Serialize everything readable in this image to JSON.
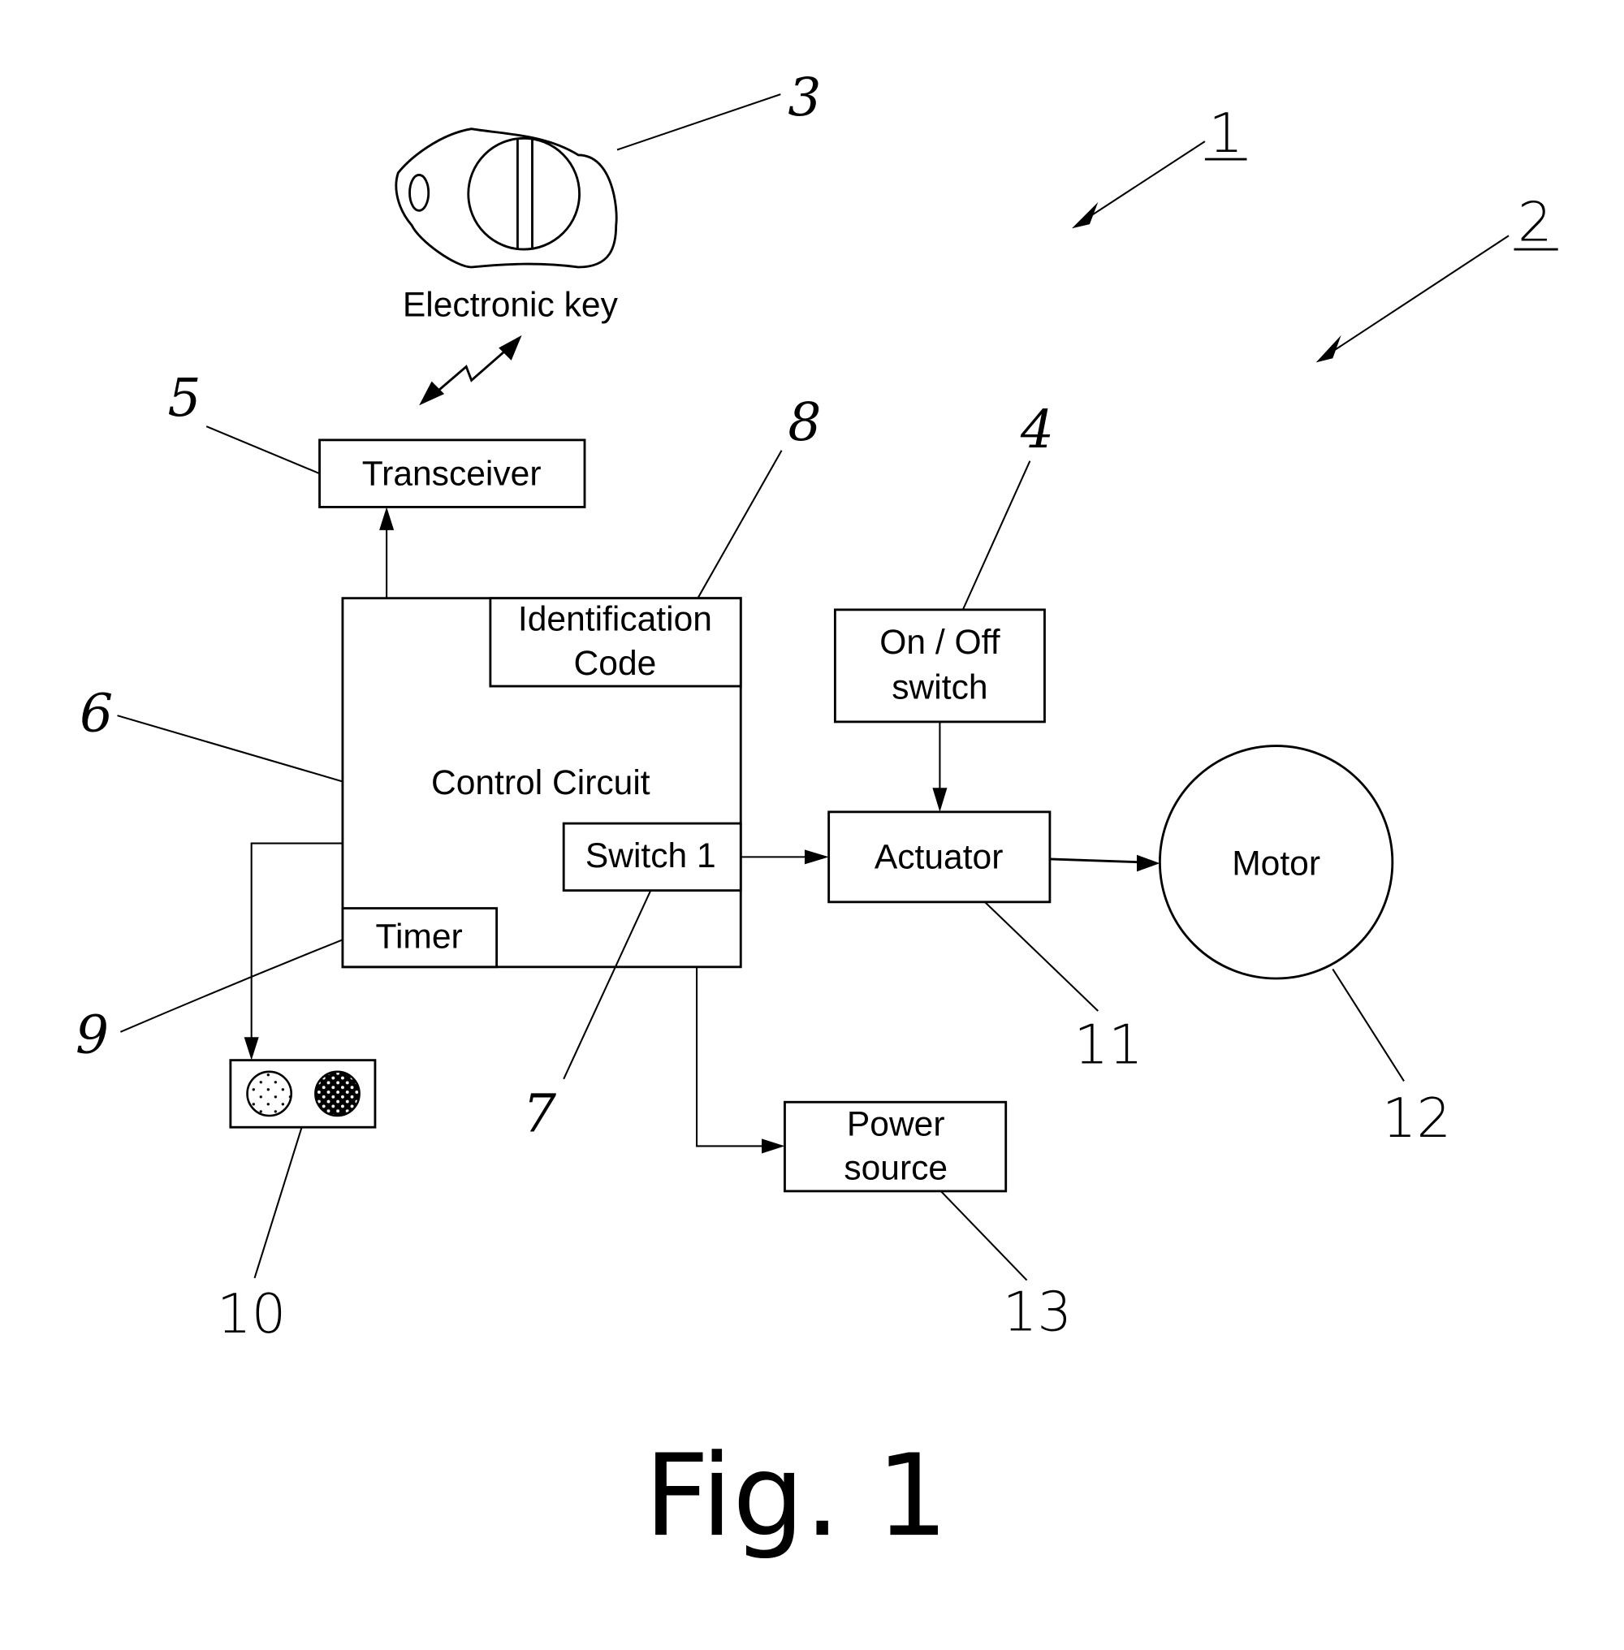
{
  "figure": {
    "caption": "Fig. 1",
    "colors": {
      "line": "#000000",
      "background": "#ffffff"
    }
  },
  "components": {
    "electronic_key": {
      "label": "Electronic key",
      "ref": "3"
    },
    "transceiver": {
      "label": "Transceiver",
      "ref": "5"
    },
    "control_circuit": {
      "label": "Control Circuit",
      "ref": "6"
    },
    "identification_code": {
      "line1": "Identification",
      "line2": "Code",
      "ref": "8"
    },
    "switch1": {
      "label": "Switch 1",
      "ref": "7"
    },
    "timer": {
      "label": "Timer",
      "ref": "9"
    },
    "on_off_switch": {
      "line1": "On / Off",
      "line2": "switch",
      "ref": "4"
    },
    "actuator": {
      "label": "Actuator",
      "ref": "11"
    },
    "motor": {
      "label": "Motor",
      "ref": "12"
    },
    "power_source": {
      "line1": "Power",
      "line2": "source",
      "ref": "13"
    },
    "indicator": {
      "ref": "10",
      "lamps": [
        "light-dotted",
        "dark-dotted"
      ]
    }
  },
  "system_refs": {
    "system": "1",
    "vehicle": "2"
  },
  "icons": {
    "wireless": "wireless-link-icon",
    "key": "key-fob-icon",
    "indicator": "indicator-lamps-icon"
  }
}
